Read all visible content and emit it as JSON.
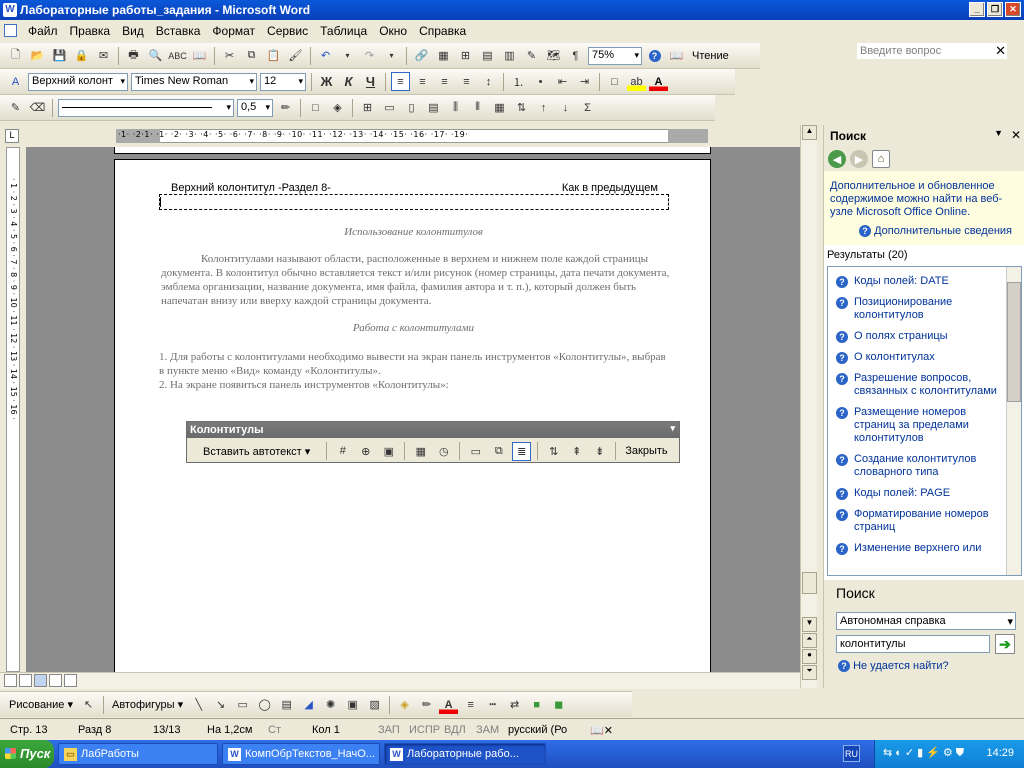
{
  "window": {
    "title": "Лабораторные работы_задания - Microsoft Word"
  },
  "menu": {
    "items": [
      "Файл",
      "Правка",
      "Вид",
      "Вставка",
      "Формат",
      "Сервис",
      "Таблица",
      "Окно",
      "Справка"
    ],
    "help_placeholder": "Введите вопрос"
  },
  "toolbar1": {
    "zoom": "75%",
    "reading": "Чтение"
  },
  "toolbar2": {
    "style": "Верхний колонт",
    "font": "Times New Roman",
    "size": "12",
    "bold": "Ж",
    "italic": "К",
    "underline": "Ч"
  },
  "toolbar3": {
    "line_weight": "0,5"
  },
  "ruler": {
    "numbers": "·1·  ·2·1· ·1· ·2· ·3· ·4· ·5· ·6· ·7· ·8· ·9· ·10· ·11· ·12· ·13· ·14· ·15· ·16· ·17· ·19·"
  },
  "document": {
    "header_label": "Верхний колонтитул -Раздел 8-",
    "header_right": "Как в предыдущем",
    "heading1": "Использование колонтитулов",
    "paragraph1": "Колонтитулами называют области, расположенные в верхнем и нижнем поле каждой страницы документа. В колонтитул обычно вставляется текст и/или рисунок (номер страницы, дата печати документа, эмблема организации, название документа, имя файла, фамилия автора и т. п.), который должен быть напечатан внизу или вверху каждой страницы документа.",
    "heading2": "Работа с колонтитулами",
    "list1": "1.  Для работы с колонтитулами необходимо вывести на экран панель инструментов «Колонтитулы», выбрав в пункте меню «Вид» команду «Колонтитулы».",
    "list2": "2.  На экране появиться панель инструментов «Колонтитулы»:"
  },
  "kolon_toolbar": {
    "title": "Колонтитулы",
    "insert_autotext": "Вставить автотекст",
    "close": "Закрыть"
  },
  "taskpane": {
    "title": "Поиск",
    "info": "Дополнительное и обновленное содержимое можно найти на веб-узле Microsoft Office Online.",
    "more_info": "Дополнительные сведения",
    "results_header": "Результаты (20)",
    "results": [
      "Коды полей: DATE",
      "Позиционирование колонтитулов",
      "О полях страницы",
      "О колонтитулах",
      "Разрешение вопросов, связанных с колонтитулами",
      "Размещение номеров страниц за пределами колонтитулов",
      "Создание колонтитулов словарного типа",
      "Коды полей: PAGE",
      "Форматирование номеров страниц",
      "Изменение верхнего или"
    ],
    "search_label": "Поиск",
    "search_scope": "Автономная справка",
    "search_query": "колонтитулы",
    "not_found": "Не удается найти?"
  },
  "drawbar": {
    "draw": "Рисование",
    "autoshapes": "Автофигуры"
  },
  "status": {
    "page": "Стр.  13",
    "section": "Разд  8",
    "pages": "13/13",
    "at": "На  1,2см",
    "line_abbr": "Ст",
    "col": "Кол  1",
    "rec": "ЗАП",
    "trk": "ИСПР",
    "ext": "ВДЛ",
    "ovr": "ЗАМ",
    "lang": "русский (Ро"
  },
  "taskbar": {
    "start": "Пуск",
    "tasks": [
      "ЛабРаботы",
      "КомпОбрТекстов_НачО...",
      "Лабораторные рабо..."
    ],
    "lang": "RU",
    "clock": "14:29"
  }
}
